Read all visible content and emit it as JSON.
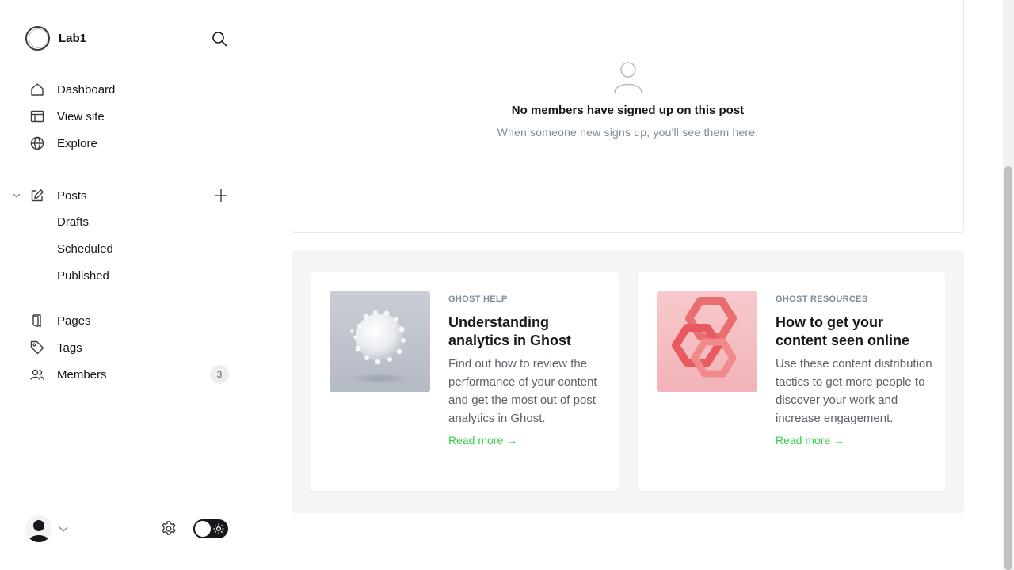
{
  "brand": {
    "name": "Lab1"
  },
  "nav": {
    "dashboard": "Dashboard",
    "view_site": "View site",
    "explore": "Explore",
    "posts": "Posts",
    "drafts": "Drafts",
    "scheduled": "Scheduled",
    "published": "Published",
    "pages": "Pages",
    "tags": "Tags",
    "members": "Members",
    "members_count": "3"
  },
  "empty_state": {
    "title": "No members have signed up on this post",
    "subtitle": "When someone new signs up, you'll see them here."
  },
  "resources": [
    {
      "kicker": "GHOST HELP",
      "title": "Understanding analytics in Ghost",
      "description": "Find out how to review the performance of your content and get the most out of post analytics in Ghost.",
      "link": "Read more →"
    },
    {
      "kicker": "GHOST RESOURCES",
      "title": "How to get your content seen online",
      "description": "Use these content distribution tactics to get more people to discover your work and increase engagement.",
      "link": "Read more →"
    }
  ],
  "colors": {
    "accent_green": "#30cf43",
    "muted_text": "#7c8b9a",
    "text": "#15171a"
  }
}
